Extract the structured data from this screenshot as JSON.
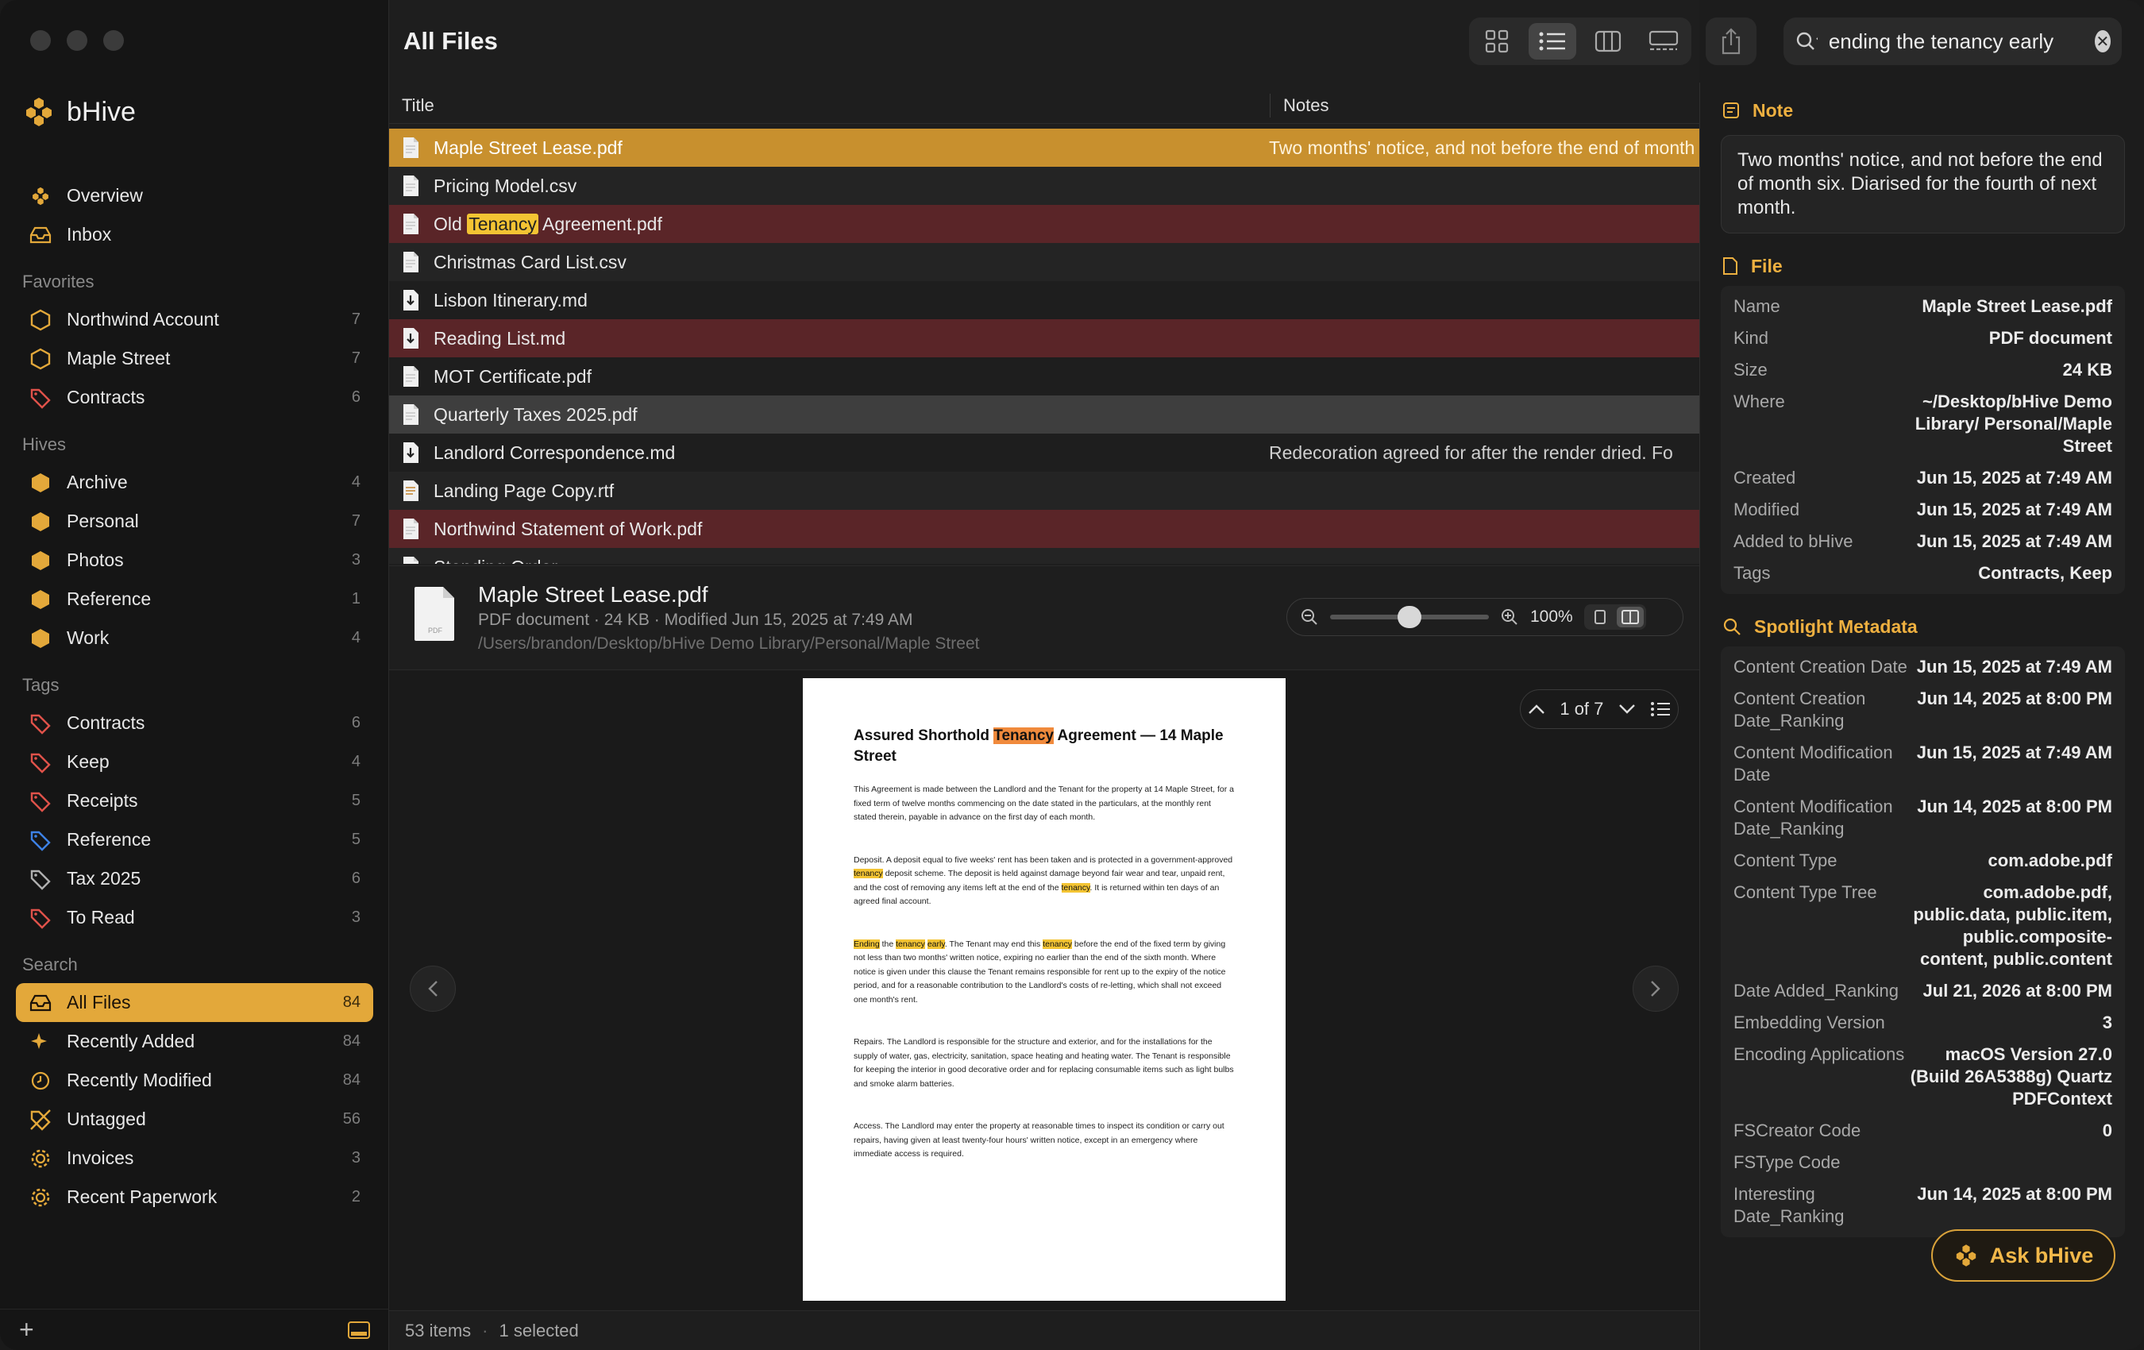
{
  "app": {
    "name": "bHive"
  },
  "sidebar": {
    "top": [
      {
        "label": "Overview",
        "icon": "honeycomb-icon"
      },
      {
        "label": "Inbox",
        "icon": "inbox-icon"
      }
    ],
    "favorites_title": "Favorites",
    "favorites": [
      {
        "label": "Northwind Account",
        "count": "7",
        "icon": "hexagon-outline-icon"
      },
      {
        "label": "Maple Street",
        "count": "7",
        "icon": "hexagon-outline-icon"
      },
      {
        "label": "Contracts",
        "count": "6",
        "icon": "tag-icon"
      }
    ],
    "hives_title": "Hives",
    "hives": [
      {
        "label": "Archive",
        "count": "4"
      },
      {
        "label": "Personal",
        "count": "7"
      },
      {
        "label": "Photos",
        "count": "3"
      },
      {
        "label": "Reference",
        "count": "1"
      },
      {
        "label": "Work",
        "count": "4"
      }
    ],
    "tags_title": "Tags",
    "tags": [
      {
        "label": "Contracts",
        "count": "6",
        "color": "#e0524a"
      },
      {
        "label": "Keep",
        "count": "4",
        "color": "#e0524a"
      },
      {
        "label": "Receipts",
        "count": "5",
        "color": "#e0524a"
      },
      {
        "label": "Reference",
        "count": "5",
        "color": "#3d82e6"
      },
      {
        "label": "Tax 2025",
        "count": "6",
        "color": "#b0b0b0"
      },
      {
        "label": "To Read",
        "count": "3",
        "color": "#e0524a"
      }
    ],
    "search_title": "Search",
    "searches": [
      {
        "label": "All Files",
        "count": "84",
        "icon": "inbox-icon",
        "active": true
      },
      {
        "label": "Recently Added",
        "count": "84",
        "icon": "sparkle-icon"
      },
      {
        "label": "Recently Modified",
        "count": "84",
        "icon": "clock-icon"
      },
      {
        "label": "Untagged",
        "count": "56",
        "icon": "untag-icon"
      },
      {
        "label": "Invoices",
        "count": "3",
        "icon": "gear-icon"
      },
      {
        "label": "Recent Paperwork",
        "count": "2",
        "icon": "gear-icon"
      }
    ]
  },
  "header": {
    "title": "All Files"
  },
  "search": {
    "query": "ending the tenancy early"
  },
  "table": {
    "col_title": "Title",
    "col_notes": "Notes",
    "rows": [
      {
        "pre": "Maple Street Lease.pdf",
        "hit": "",
        "post": "",
        "note": "Two months' notice, and not before the end of month six. Diarised for the fourth of next month.",
        "style": "sel",
        "kind": "doc"
      },
      {
        "pre": "Pricing Model.csv",
        "hit": "",
        "post": "",
        "note": "",
        "style": "",
        "kind": "doc"
      },
      {
        "pre": "Old ",
        "hit": "Tenancy",
        "post": " Agreement.pdf",
        "note": "",
        "style": "tag-red",
        "kind": "doc"
      },
      {
        "pre": "Christmas Card List.csv",
        "hit": "",
        "post": "",
        "note": "",
        "style": "",
        "kind": "doc"
      },
      {
        "pre": "Lisbon Itinerary.md",
        "hit": "",
        "post": "",
        "note": "",
        "style": "",
        "kind": "md"
      },
      {
        "pre": "Reading List.md",
        "hit": "",
        "post": "",
        "note": "",
        "style": "tag-red",
        "kind": "md"
      },
      {
        "pre": "MOT Certificate.pdf",
        "hit": "",
        "post": "",
        "note": "",
        "style": "",
        "kind": "doc"
      },
      {
        "pre": "Quarterly Taxes 2025.pdf",
        "hit": "",
        "post": "",
        "note": "",
        "style": "hl",
        "kind": "doc"
      },
      {
        "pre": "Landlord Correspondence.md",
        "hit": "",
        "post": "",
        "note": "Redecoration agreed for after the render dried. Fo",
        "style": "",
        "kind": "md"
      },
      {
        "pre": "Landing Page Copy.rtf",
        "hit": "",
        "post": "",
        "note": "",
        "style": "",
        "kind": "rtf"
      },
      {
        "pre": "Northwind Statement of Work.pdf",
        "hit": "",
        "post": "",
        "note": "",
        "style": "tag-red",
        "kind": "doc"
      },
      {
        "pre": "Standing Order...",
        "hit": "",
        "post": "",
        "note": "",
        "style": "",
        "kind": "doc"
      }
    ]
  },
  "preview": {
    "title": "Maple Street Lease.pdf",
    "meta": "PDF document · 24 KB · Modified Jun 15, 2025 at 7:49 AM",
    "path": "/Users/brandon/Desktop/bHive Demo Library/Personal/Maple Street",
    "zoom": "100%",
    "zoom_level": 0.5,
    "page": "1 of 7",
    "doc": {
      "title_pre": "Assured Shorthold ",
      "title_hit": "Tenancy",
      "title_post": " Agreement — 14 Maple Street",
      "p1": "This Agreement is made between the Landlord and the Tenant for the property at 14 Maple Street, for a fixed term of twelve months commencing on the date stated in the particulars, at the monthly rent stated therein, payable in advance on the first day of each month.",
      "p2a": "Deposit. A deposit equal to five weeks' rent has been taken and is protected in a government-approved ",
      "p2h1": "tenancy",
      "p2b": " deposit scheme. The deposit is held against damage beyond fair wear and tear, unpaid rent, and the cost of removing any items left at the end of the ",
      "p2h2": "tenancy",
      "p2c": ". It is returned within ten days of an agreed final account.",
      "p3h1": "Ending",
      "p3a": " the ",
      "p3h2": "tenancy",
      "p3b": " ",
      "p3h3": "early",
      "p3c": ". The Tenant may end this ",
      "p3h4": "tenancy",
      "p3d": " before the end of the fixed term by giving not less than two months' written notice, expiring no earlier than the end of the sixth month. Where notice is given under this clause the Tenant remains responsible for rent up to the expiry of the notice period, and for a reasonable contribution to the Landlord's costs of re-letting, which shall not exceed one month's rent.",
      "p4": "Repairs. The Landlord is responsible for the structure and exterior, and for the installations for the supply of water, gas, electricity, sanitation, space heating and heating water. The Tenant is responsible for keeping the interior in good decorative order and for replacing consumable items such as light bulbs and smoke alarm batteries.",
      "p5": "Access. The Landlord may enter the property at reasonable times to inspect its condition or carry out repairs, having given at least twenty-four hours' written notice, except in an emergency where immediate access is required."
    }
  },
  "status": {
    "items": "53 items",
    "selected": "1 selected"
  },
  "inspector": {
    "note_title": "Note",
    "note": "Two months' notice, and not before the end of month six. Diarised for the fourth of next month.",
    "file_title": "File",
    "file": [
      {
        "k": "Name",
        "v": "Maple Street Lease.pdf"
      },
      {
        "k": "Kind",
        "v": "PDF document"
      },
      {
        "k": "Size",
        "v": "24 KB"
      },
      {
        "k": "Where",
        "v": "~/Desktop/bHive Demo Library/ Personal/Maple Street"
      },
      {
        "k": "Created",
        "v": "Jun 15, 2025 at 7:49 AM"
      },
      {
        "k": "Modified",
        "v": "Jun 15, 2025 at 7:49 AM"
      },
      {
        "k": "Added to bHive",
        "v": "Jun 15, 2025 at 7:49 AM"
      },
      {
        "k": "Tags",
        "v": "Contracts, Keep"
      }
    ],
    "spot_title": "Spotlight Metadata",
    "spot": [
      {
        "k": "Content Creation Date",
        "v": "Jun 15, 2025 at 7:49 AM"
      },
      {
        "k": "Content Creation Date_Ranking",
        "v": "Jun 14, 2025 at 8:00 PM"
      },
      {
        "k": "Content Modification Date",
        "v": "Jun 15, 2025 at 7:49 AM"
      },
      {
        "k": "Content Modification Date_Ranking",
        "v": "Jun 14, 2025 at 8:00 PM"
      },
      {
        "k": "Content Type",
        "v": "com.adobe.pdf"
      },
      {
        "k": "Content Type Tree",
        "v": "com.adobe.pdf, public.data, public.item, public.composite-content, public.content"
      },
      {
        "k": "Date Added_Ranking",
        "v": "Jul 21, 2026 at 8:00 PM"
      },
      {
        "k": "Embedding Version",
        "v": "3"
      },
      {
        "k": "Encoding Applications",
        "v": "macOS Version 27.0 (Build 26A5388g) Quartz PDFContext"
      },
      {
        "k": "FSCreator Code",
        "v": "0"
      },
      {
        "k": "FSType Code",
        "v": ""
      },
      {
        "k": "Interesting Date_Ranking",
        "v": "Jun 14, 2025 at 8:00 PM"
      }
    ],
    "ask_label": "Ask bHive"
  },
  "colors": {
    "accent": "#e3a83a",
    "tag_red_row": "#5a2528",
    "selected_row": "#c8902e"
  }
}
